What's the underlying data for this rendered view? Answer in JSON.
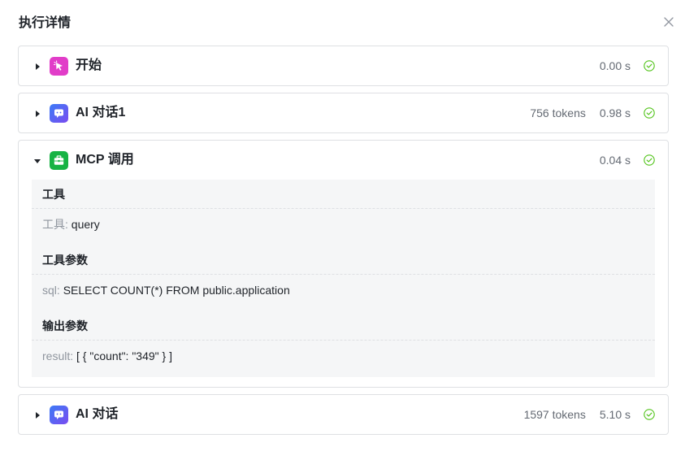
{
  "dialog": {
    "title": "执行详情"
  },
  "nodes": [
    {
      "name": "开始",
      "time": "0.00 s",
      "expanded": false
    },
    {
      "name": "AI 对话1",
      "tokens": "756 tokens",
      "time": "0.98 s",
      "expanded": false
    },
    {
      "name": "MCP 调用",
      "time": "0.04 s",
      "expanded": true,
      "sections": [
        {
          "title": "工具",
          "key": "工具:",
          "value": "query"
        },
        {
          "title": "工具参数",
          "key": "sql:",
          "value": "SELECT COUNT(*) FROM public.application"
        },
        {
          "title": "输出参数",
          "key": "result:",
          "value": "[ { \"count\": \"349\" } ]"
        }
      ]
    },
    {
      "name": "AI 对话",
      "tokens": "1597 tokens",
      "time": "5.10 s",
      "expanded": false
    }
  ],
  "colors": {
    "start_icon": "#e13dc8",
    "ai_icon": "#4e5ff2",
    "mcp_icon": "#17b344",
    "success": "#52c41a"
  },
  "icons": {
    "start": "pointer-click-icon",
    "ai": "chat-bubble-icon",
    "mcp": "toolbox-icon",
    "status": "check-circle-icon",
    "close": "close-icon"
  }
}
